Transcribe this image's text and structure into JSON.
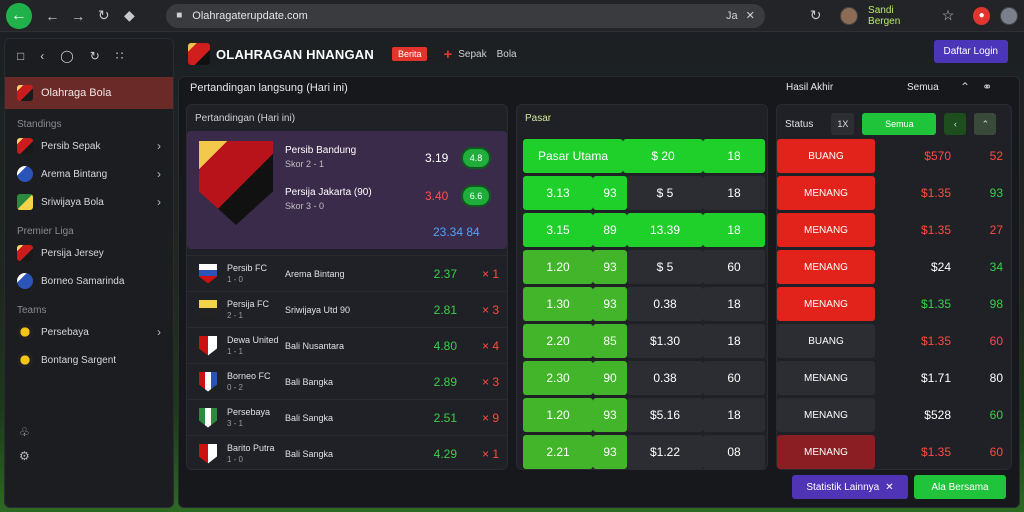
{
  "browser": {
    "url": "Olahragaterupdate.com",
    "tail_text": "Ja",
    "profile_name": "Sandi Bergen"
  },
  "sidebar": {
    "active": "Olahraga Bola",
    "section1": "Standings",
    "items1": [
      {
        "label": "Persib Sepak",
        "crest": "c-red",
        "chev": true
      },
      {
        "label": "Arema Bintang",
        "crest": "c-blue",
        "chev": true
      },
      {
        "label": "Sriwijaya Bola",
        "crest": "c-green",
        "chev": true
      }
    ],
    "section2": "Premier Liga",
    "items2": [
      {
        "label": "Persija Jersey",
        "crest": "c-red",
        "chev": false
      },
      {
        "label": "Borneo Samarinda",
        "crest": "c-blue",
        "chev": false
      }
    ],
    "section3": "Teams",
    "items3": [
      {
        "label": "Persebaya",
        "crest": "c-yellow",
        "chev": true
      },
      {
        "label": "Bontang Sargent",
        "crest": "c-yellow",
        "chev": false
      }
    ]
  },
  "topbar": {
    "title": "OLAHRAGAN HNANGAN",
    "live": "Berita",
    "link1": "Sepak",
    "link2": "Bola",
    "signin": "Daftar Login"
  },
  "main": {
    "subtitle": "Pertandingan langsung (Hari ini)",
    "left_header": "Pertandingan (Hari ini)",
    "right_title": "Hasil Akhir",
    "right_select": "Semua",
    "mid_header": "Pasar",
    "right_label": "Status",
    "right_btn_small": "1X",
    "right_btn_green": "Semua"
  },
  "featured": {
    "team1": "Persib Bandung",
    "score1": "Skor 2 - 1",
    "team2": "Persija Jakarta (90)",
    "score2": "Skor 3 - 0",
    "odd1": "3.19",
    "odd2": "3.40",
    "pill1": "4.8",
    "pill2": "6.6",
    "total": "23.34 84"
  },
  "matches": [
    {
      "t1": "Persib FC",
      "sub": "1 - 0",
      "t2": "Arema Bintang",
      "odd": "2.37",
      "x": "1",
      "shield": "linear-gradient(180deg,#fff 0 30%,#2a54b8 30% 60%,#c11 60%)"
    },
    {
      "t1": "Persija FC",
      "sub": "2 - 1",
      "t2": "Sriwijaya Utd 90",
      "odd": "2.81",
      "x": "3",
      "shield": "linear-gradient(180deg,#f2d34a 0 40%,#222 40%)"
    },
    {
      "t1": "Dewa United",
      "sub": "1 - 1",
      "t2": "Bali Nusantara",
      "odd": "4.80",
      "x": "4",
      "shield": "linear-gradient(90deg,#c11 0 50%,#fff 50%)"
    },
    {
      "t1": "Borneo FC",
      "sub": "0 - 2",
      "t2": "Bali Bangka",
      "odd": "2.89",
      "x": "3",
      "shield": "linear-gradient(90deg,#c11 0 33%,#fff 33% 66%,#2a54b8 66%)"
    },
    {
      "t1": "Persebaya",
      "sub": "3 - 1",
      "t2": "Bali Sangka",
      "odd": "2.51",
      "x": "9",
      "shield": "linear-gradient(90deg,#2b8a3e 0 33%,#fff 33% 66%,#2b8a3e 66%)"
    },
    {
      "t1": "Barito Putra",
      "sub": "1 - 0",
      "t2": "Bali Sangka",
      "odd": "4.29",
      "x": "1",
      "shield": "linear-gradient(90deg,#c11 0 50%,#fff 50%)"
    }
  ],
  "mid_rows": [
    {
      "cells": [
        {
          "t": "Pasar Utama",
          "w": 100,
          "c": "g-bright"
        },
        {
          "t": "$ 20",
          "w": 80,
          "c": "g-bright"
        },
        {
          "t": "18",
          "w": 62,
          "c": "g-bright"
        }
      ]
    },
    {
      "cells": [
        {
          "t": "3.13",
          "w": 70,
          "c": "g-bright"
        },
        {
          "t": "93",
          "w": 34,
          "c": "g-bright"
        },
        {
          "t": "$ 5",
          "w": 76,
          "c": "g-dark"
        },
        {
          "t": "18",
          "w": 62,
          "c": "g-dark"
        }
      ]
    },
    {
      "cells": [
        {
          "t": "3.15",
          "w": 70,
          "c": "g-bright"
        },
        {
          "t": "89",
          "w": 34,
          "c": "g-bright"
        },
        {
          "t": "13.39",
          "w": 76,
          "c": "g-bright"
        },
        {
          "t": "18",
          "w": 62,
          "c": "g-bright"
        }
      ]
    },
    {
      "cells": [
        {
          "t": "1.20",
          "w": 70,
          "c": "g-mid"
        },
        {
          "t": "93",
          "w": 34,
          "c": "g-mid"
        },
        {
          "t": "$ 5",
          "w": 76,
          "c": "g-dark"
        },
        {
          "t": "60",
          "w": 62,
          "c": "g-dark"
        }
      ]
    },
    {
      "cells": [
        {
          "t": "1.30",
          "w": 70,
          "c": "g-mid"
        },
        {
          "t": "93",
          "w": 34,
          "c": "g-mid"
        },
        {
          "t": "0.38",
          "w": 76,
          "c": "g-dark"
        },
        {
          "t": "18",
          "w": 62,
          "c": "g-dark"
        }
      ]
    },
    {
      "cells": [
        {
          "t": "2.20",
          "w": 70,
          "c": "g-mid"
        },
        {
          "t": "85",
          "w": 34,
          "c": "g-mid"
        },
        {
          "t": "$1.30",
          "w": 76,
          "c": "g-dark"
        },
        {
          "t": "18",
          "w": 62,
          "c": "g-dark"
        }
      ]
    },
    {
      "cells": [
        {
          "t": "2.30",
          "w": 70,
          "c": "g-mid"
        },
        {
          "t": "90",
          "w": 34,
          "c": "g-mid"
        },
        {
          "t": "0.38",
          "w": 76,
          "c": "g-dark"
        },
        {
          "t": "60",
          "w": 62,
          "c": "g-dark"
        }
      ]
    },
    {
      "cells": [
        {
          "t": "1.20",
          "w": 70,
          "c": "g-mid"
        },
        {
          "t": "93",
          "w": 34,
          "c": "g-mid"
        },
        {
          "t": "$5.16",
          "w": 76,
          "c": "g-dark"
        },
        {
          "t": "18",
          "w": 62,
          "c": "g-dark"
        }
      ]
    },
    {
      "cells": [
        {
          "t": "2.21",
          "w": 70,
          "c": "g-mid"
        },
        {
          "t": "93",
          "w": 34,
          "c": "g-mid"
        },
        {
          "t": "$1.22",
          "w": 76,
          "c": "g-dark"
        },
        {
          "t": "08",
          "w": 62,
          "c": "g-dark"
        }
      ]
    }
  ],
  "right_rows": [
    {
      "label": "BUANG",
      "cls": "r-red",
      "price": "$570",
      "num": "52",
      "pc": "#ff4a40",
      "nc": "#ff4a40"
    },
    {
      "label": "MENANG",
      "cls": "r-red",
      "price": "$1.35",
      "num": "93",
      "pc": "#ff4a40",
      "nc": "#36d04a"
    },
    {
      "label": "MENANG",
      "cls": "r-red",
      "price": "$1.35",
      "num": "27",
      "pc": "#ff4a40",
      "nc": "#ff4a40"
    },
    {
      "label": "MENANG",
      "cls": "r-red",
      "price": "$24",
      "num": "34",
      "pc": "#ffffff",
      "nc": "#36d04a"
    },
    {
      "label": "MENANG",
      "cls": "r-red",
      "price": "$1.35",
      "num": "98",
      "pc": "#36d04a",
      "nc": "#36d04a"
    },
    {
      "label": "BUANG",
      "cls": "r-dark",
      "price": "$1.35",
      "num": "60",
      "pc": "#ff4a40",
      "nc": "#ff4a40"
    },
    {
      "label": "MENANG",
      "cls": "r-dark",
      "price": "$1.71",
      "num": "80",
      "pc": "#ffffff",
      "nc": "#ffffff"
    },
    {
      "label": "MENANG",
      "cls": "r-dark",
      "price": "$528",
      "num": "60",
      "pc": "#ffffff",
      "nc": "#36d04a"
    },
    {
      "label": "MENANG",
      "cls": "r-maroon",
      "price": "$1.35",
      "num": "60",
      "pc": "#ff4a40",
      "nc": "#ff4a40"
    }
  ],
  "footer": {
    "btn1": "Statistik Lainnya",
    "btn2": "Ala Bersama"
  }
}
